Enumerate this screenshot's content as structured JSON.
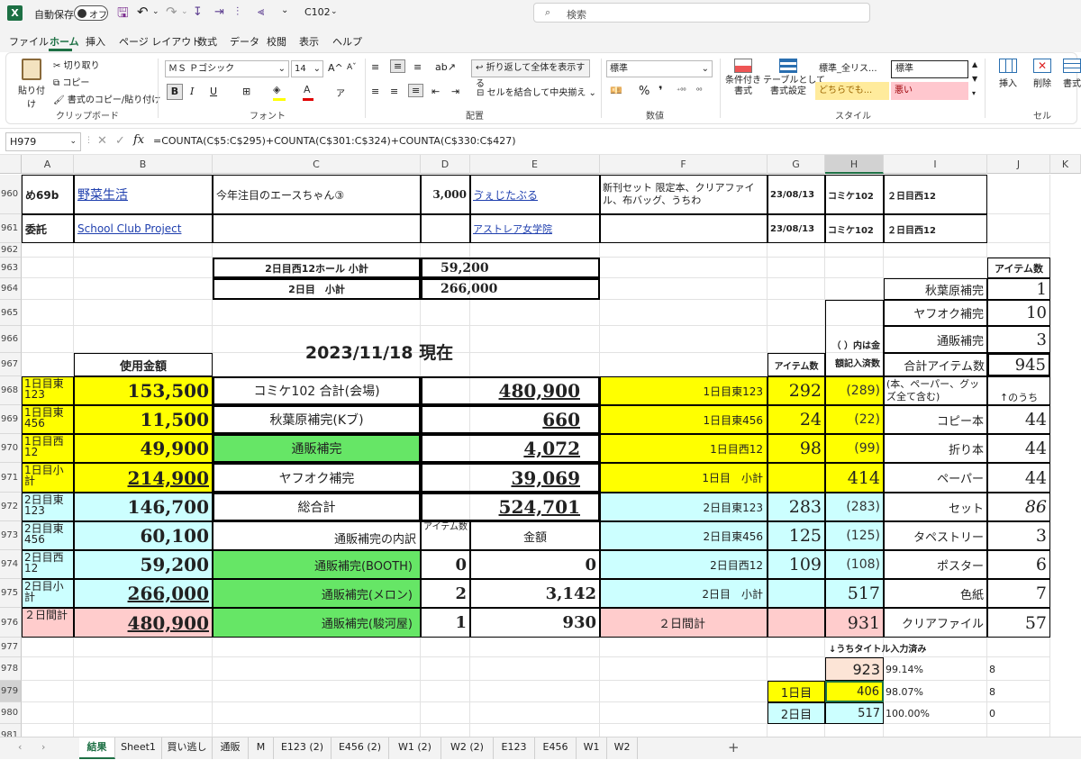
{
  "titlebar": {
    "autosave_label": "自動保存",
    "autosave_state": "オフ",
    "file_name": "C102",
    "search_placeholder": "検索"
  },
  "menu": [
    "ファイル",
    "ホーム",
    "挿入",
    "ページ レイアウト",
    "数式",
    "データ",
    "校閲",
    "表示",
    "ヘルプ"
  ],
  "ribbon": {
    "paste": "貼り付け",
    "cut": "切り取り",
    "copy": "コピー",
    "format_painter": "書式のコピー/貼り付け",
    "clipboard_group": "クリップボード",
    "font_name": "ＭＳ Ｐゴシック",
    "font_size": "14",
    "font_group": "フォント",
    "wrap_text": "折り返して全体を表示する",
    "merge_center": "セルを結合して中央揃え",
    "alignment_group": "配置",
    "number_format": "標準",
    "number_group": "数値",
    "conditional_format": "条件付き\n書式",
    "format_table": "テーブルとして\n書式設定",
    "style_standard_all": "標準_全リス...",
    "style_standard": "標準",
    "style_neutral": "どちらでも...",
    "style_bad": "悪い",
    "styles_group": "スタイル",
    "insert": "挿入",
    "delete": "削除",
    "format": "書式",
    "cells_group": "セル"
  },
  "formulabar": {
    "name_box": "H979",
    "formula": "=COUNTA(C$5:C$295)+COUNTA(C$301:C$324)+COUNTA(C$330:C$427)"
  },
  "columns": [
    "A",
    "B",
    "C",
    "D",
    "E",
    "F",
    "G",
    "H",
    "I",
    "J",
    "K"
  ],
  "rows": [
    "960",
    "961",
    "962",
    "963",
    "964",
    "965",
    "966",
    "967",
    "968",
    "969",
    "970",
    "971",
    "972",
    "973",
    "974",
    "975",
    "976",
    "977",
    "978",
    "979",
    "980",
    "981"
  ],
  "cells": {
    "a960": "め69b",
    "b960": "野菜生活",
    "c960": "今年注目のエースちゃん③",
    "d960": "3,000",
    "e960": "ゔぇじたぶる",
    "f960": "新刊セット 限定本、クリアファイル、布バッグ、うちわ",
    "g960": "23/08/13",
    "h960": "コミケ102",
    "i960": "２日目西12",
    "a961": "委託",
    "b961": "School Club Project",
    "e961": "アストレア女学院",
    "g961": "23/08/13",
    "h961": "コミケ102",
    "i961": "２日目西12",
    "c963": "2日目西12ホール 小計",
    "d963": "59,200",
    "c964": "2日目　小計",
    "d964": "266,000",
    "c966": "2023/11/18 現在",
    "b967": "使用金額",
    "g967": "アイテム数",
    "h966": "（ ）内は金額記入済数",
    "j963": "アイテム数",
    "i964": "秋葉原補完",
    "j964": "1",
    "i965": "ヤフオク補完",
    "j965": "10",
    "i966": "通販補完",
    "j966": "3",
    "i967": "合計アイテム数",
    "j967": "945",
    "i968": "(本、ペーパー、グッズ全て含む)",
    "j968": "↑のうち",
    "a968": "1日目東123",
    "b968": "153,500",
    "c968": "コミケ102 合計(会場)",
    "d968": "480,900",
    "f968": "1日目東123",
    "g968": "292",
    "h968": "(289)",
    "a969": "1日目東456",
    "b969": "11,500",
    "c969": "秋葉原補完(Kブ)",
    "d969": "660",
    "f969": "1日目東456",
    "g969": "24",
    "h969": "(22)",
    "i969": "コピー本",
    "j969": "44",
    "a970": "1日目西12",
    "b970": "49,900",
    "c970": "通販補完",
    "d970": "4,072",
    "f970": "1日目西12",
    "g970": "98",
    "h970": "(99)",
    "i970": "折り本",
    "j970": "44",
    "a971": "1日目小計",
    "b971": "214,900",
    "c971": "ヤフオク補完",
    "d971": "39,069",
    "f971": "1日目　小計",
    "h971": "414",
    "i971": "ペーパー",
    "j971": "44",
    "a972": "2日目東123",
    "b972": "146,700",
    "c972": "総合計",
    "d972": "524,701",
    "f972": "2日目東123",
    "g972": "283",
    "h972": "(283)",
    "i972": "セット",
    "j972": "86",
    "a973": "2日目東456",
    "b973": "60,100",
    "c973": "通販補完の内訳",
    "d973": "アイテム数",
    "e973": "金額",
    "f973": "2日目東456",
    "g973": "125",
    "h973": "(125)",
    "i973": "タペストリー",
    "j973": "3",
    "a974": "2日目西12",
    "b974": "59,200",
    "c974": "通販補完(BOOTH)",
    "d974": "0",
    "e974": "0",
    "f974": "2日目西12",
    "g974": "109",
    "h974": "(108)",
    "i974": "ポスター",
    "j974": "6",
    "a975": "2日目小計",
    "b975": "266,000",
    "c975": "通販補完(メロン)",
    "d975": "2",
    "e975": "3,142",
    "f975": "2日目　小計",
    "h975": "517",
    "i975": "色紙",
    "j975": "7",
    "a976": "２日間計",
    "b976": "480,900",
    "c976": "通販補完(駿河屋)",
    "d976": "1",
    "e976": "930",
    "f976": "２日間計",
    "h976": "931",
    "i976": "クリアファイル",
    "j976": "57",
    "h977": "↓うちタイトル入力済み",
    "h978": "923",
    "i978": "99.14%",
    "j978": "8",
    "g979": "1日目",
    "h979": "406",
    "i979": "98.07%",
    "j979": "8",
    "g980": "2日目",
    "h980": "517",
    "i980": "100.00%",
    "j980": "0"
  },
  "sheet_tabs": [
    "結果",
    "Sheet1",
    "買い逃し",
    "通販",
    "M",
    "E123 (2)",
    "E456 (2)",
    "W1 (2)",
    "W2 (2)",
    "E123",
    "E456",
    "W1",
    "W2"
  ],
  "active_tab": "結果"
}
